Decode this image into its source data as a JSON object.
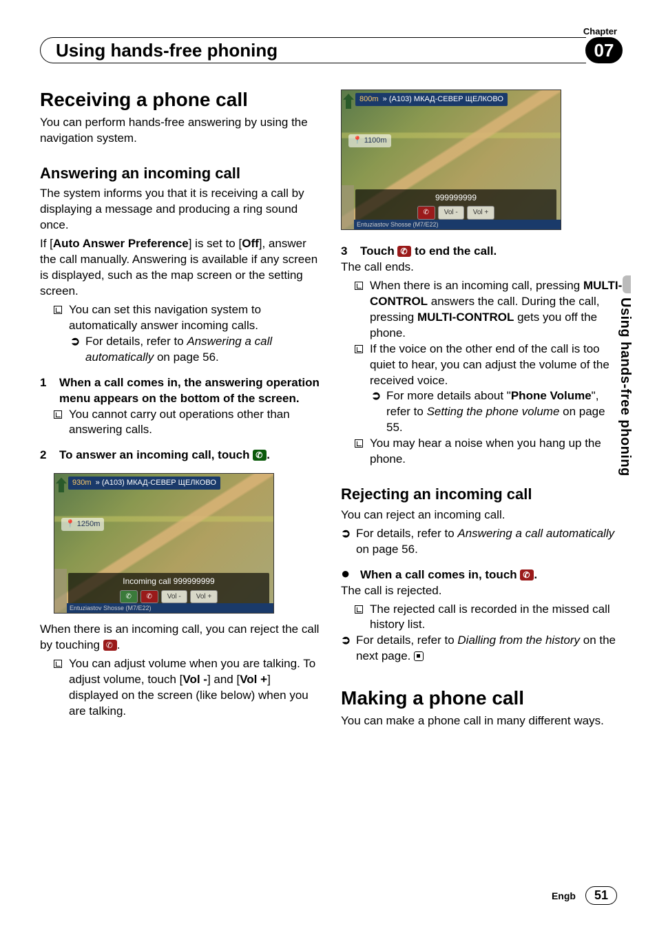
{
  "header": {
    "chapter_label": "Chapter",
    "title": "Using hands-free phoning",
    "chapter_num": "07"
  },
  "side_tab": "Using hands-free phoning",
  "left": {
    "h1": "Receiving a phone call",
    "intro": "You can perform hands-free answering by using the navigation system.",
    "h2a": "Answering an incoming call",
    "p1": "The system informs you that it is receiving a call by displaying a message and producing a ring sound once.",
    "p2_pre": "If [",
    "p2_b1": "Auto Answer Preference",
    "p2_mid": "] is set to [",
    "p2_b2": "Off",
    "p2_post": "], answer the call manually. Answering is available if any screen is displayed, such as the map screen or the setting screen.",
    "bullet1": "You can set this navigation system to automatically answer incoming calls.",
    "sub1_pre": "For details, refer to ",
    "sub1_i": "Answering a call automatically",
    "sub1_post": " on page 56.",
    "step1": "When a call comes in, the answering operation menu appears on the bottom of the screen.",
    "step1_bullet": "You cannot carry out operations other than answering calls.",
    "step2_pre": "To answer an incoming call, touch ",
    "step2_post": ".",
    "screenshot1": {
      "dist_top": "930m",
      "route": "» (A103) МКАД-СЕВЕР ЩЕЛКОВО",
      "dist2": "1250m",
      "call_line": "Incoming call  999999999",
      "vol_minus": "Vol -",
      "vol_plus": "Vol +",
      "bottom_road": "Entuziastov Shosse (M7/E22)"
    },
    "p3_pre": "When there is an incoming call, you can reject the call by touching ",
    "p3_post": ".",
    "bullet2_pre": "You can adjust volume when you are talking. To adjust volume, touch [",
    "bullet2_b1": "Vol -",
    "bullet2_mid": "] and [",
    "bullet2_b2": "Vol +",
    "bullet2_post": "] displayed on the screen (like below) when you are talking."
  },
  "right": {
    "screenshot2": {
      "dist_top": "800m",
      "route": "» (A103) МКАД-СЕВЕР ЩЕЛКОВО",
      "dist2": "1100m",
      "call_line": "999999999",
      "vol_minus": "Vol -",
      "vol_plus": "Vol +",
      "bottom_road": "Entuziastov Shosse (M7/E22)"
    },
    "step3_pre": "Touch ",
    "step3_post": " to end the call.",
    "p_after3": "The call ends.",
    "bullet3_pre": "When there is an incoming call,  pressing ",
    "bullet3_b1": "MULTI-CONTROL",
    "bullet3_mid": " answers the call. During the call, pressing ",
    "bullet3_b2": "MULTI-CONTROL",
    "bullet3_post": " gets you off the phone.",
    "bullet4": "If the voice on the other end of the call is too quiet to hear, you can adjust the volume of the received voice.",
    "sub4_pre": "For more details about \"",
    "sub4_b": "Phone Volume",
    "sub4_mid": "\", refer to ",
    "sub4_i": "Setting the phone volume",
    "sub4_post": " on page 55.",
    "bullet5": "You may hear a noise when you hang up the phone.",
    "h2b": "Rejecting an incoming call",
    "pb1": "You can reject an incoming call.",
    "subb_pre": "For details, refer to ",
    "subb_i": "Answering a call automatically",
    "subb_post": " on page 56.",
    "dot_step_pre": "When a call comes in, touch ",
    "dot_step_post": ".",
    "pb2": "The call is rejected.",
    "bullet6": "The rejected call is recorded in the missed call history list.",
    "sub6_pre": "For details, refer to ",
    "sub6_i": "Dialling from the history",
    "sub6_post": " on the next page.",
    "h1b": "Making a phone call",
    "pb3": "You can make a phone call in many different ways."
  },
  "footer": {
    "lang": "Engb",
    "page": "51"
  },
  "step_nums": {
    "s1": "1",
    "s2": "2",
    "s3": "3"
  }
}
